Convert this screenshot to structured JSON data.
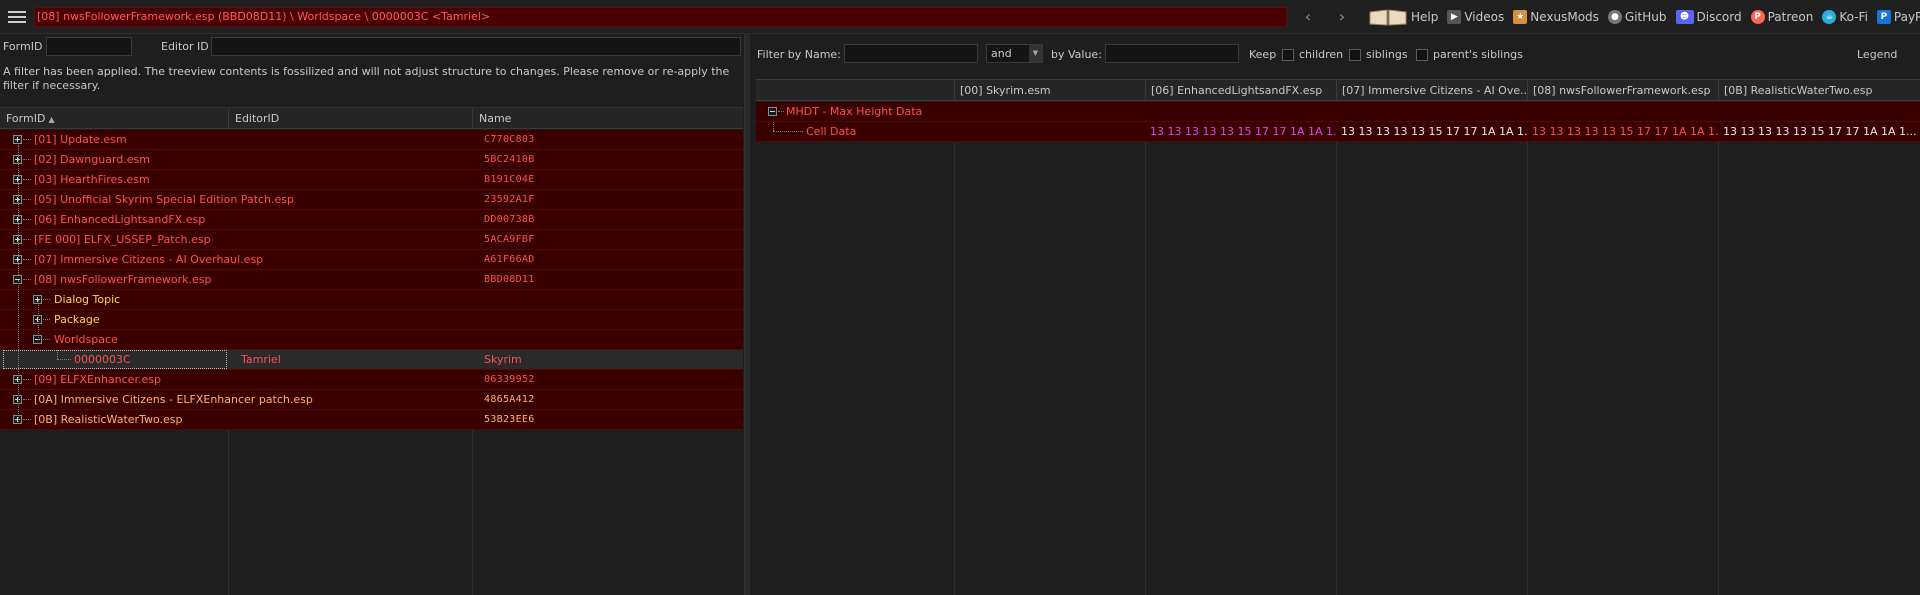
{
  "topbar": {
    "path": "[08] nwsFollowerFramework.esp (BBD08D11) \\ Worldspace \\ 0000003C <Tamriel>",
    "links": [
      {
        "label": "Help",
        "icon": "book-icon",
        "color": "#d8c8a0"
      },
      {
        "label": "Videos",
        "icon": "videos-icon",
        "color": "#555555"
      },
      {
        "label": "NexusMods",
        "icon": "nexusmods-icon",
        "color": "#d98f40"
      },
      {
        "label": "GitHub",
        "icon": "github-icon",
        "color": "#888888"
      },
      {
        "label": "Discord",
        "icon": "discord-icon",
        "color": "#5865f2"
      },
      {
        "label": "Patreon",
        "icon": "patreon-icon",
        "color": "#f96854"
      },
      {
        "label": "Ko-Fi",
        "icon": "kofi-icon",
        "color": "#29abe0"
      },
      {
        "label": "PayPal",
        "icon": "paypal-icon",
        "color": "#1a73d9"
      }
    ]
  },
  "left": {
    "formid_label": "FormID",
    "editorid_label": "Editor ID",
    "notice": "A filter has been applied. The treeview contents is fossilized and will not adjust structure to changes.  Please remove or re-apply the filter if necessary.",
    "columns": {
      "formid": "FormID",
      "editorid": "EditorID",
      "name": "Name"
    },
    "rows": [
      {
        "formid": "[01] Update.esm",
        "editorid": "",
        "name": "C770C803"
      },
      {
        "formid": "[02] Dawnguard.esm",
        "editorid": "",
        "name": "5BC2410B"
      },
      {
        "formid": "[03] HearthFires.esm",
        "editorid": "",
        "name": "B191C04E"
      },
      {
        "formid": "[05] Unofficial Skyrim Special Edition Patch.esp",
        "editorid": "",
        "name": "23592A1F"
      },
      {
        "formid": "[06] EnhancedLightsandFX.esp",
        "editorid": "",
        "name": "DD00738B"
      },
      {
        "formid": "[FE 000] ELFX_USSEP_Patch.esp",
        "editorid": "",
        "name": "5ACA9FBF"
      },
      {
        "formid": "[07] Immersive Citizens - AI Overhaul.esp",
        "editorid": "",
        "name": "A61F66AD"
      },
      {
        "formid": "[08] nwsFollowerFramework.esp",
        "editorid": "",
        "name": "BBD08D11"
      },
      {
        "formid": "Dialog Topic",
        "editorid": "",
        "name": ""
      },
      {
        "formid": "Package",
        "editorid": "",
        "name": ""
      },
      {
        "formid": "Worldspace",
        "editorid": "",
        "name": ""
      },
      {
        "formid": "0000003C",
        "editorid": "Tamriel",
        "name": "Skyrim"
      },
      {
        "formid": "[09] ELFXEnhancer.esp",
        "editorid": "",
        "name": "06339952"
      },
      {
        "formid": "[0A] Immersive Citizens - ELFXEnhancer patch.esp",
        "editorid": "",
        "name": "4865A412"
      },
      {
        "formid": "[0B] RealisticWaterTwo.esp",
        "editorid": "",
        "name": "53B23EE6"
      }
    ]
  },
  "right": {
    "filter_by_name_label": "Filter by Name:",
    "operator": "and",
    "by_value_label": "by Value:",
    "keep_label": "Keep",
    "children_label": "children",
    "siblings_label": "siblings",
    "parents_siblings_label": "parent's siblings",
    "legend_label": "Legend",
    "columns": [
      "",
      "[00] Skyrim.esm",
      "[06] EnhancedLightsandFX.esp",
      "[07] Immersive Citizens - AI Ove...",
      "[08] nwsFollowerFramework.esp",
      "[0B] RealisticWaterTwo.esp"
    ],
    "rows": [
      {
        "label": "MHDT - Max Height Data",
        "values": [
          "",
          "",
          "",
          "",
          ""
        ]
      },
      {
        "label": "Cell Data",
        "values": [
          "",
          "13 13 13 13 13 15 17 17 1A 1A 1...",
          "13 13 13 13 13 15 17 17 1A 1A 1...",
          "13 13 13 13 13 15 17 17 1A 1A 1...",
          "13 13 13 13 13 15 17 17 1A 1A 1..."
        ]
      }
    ]
  }
}
